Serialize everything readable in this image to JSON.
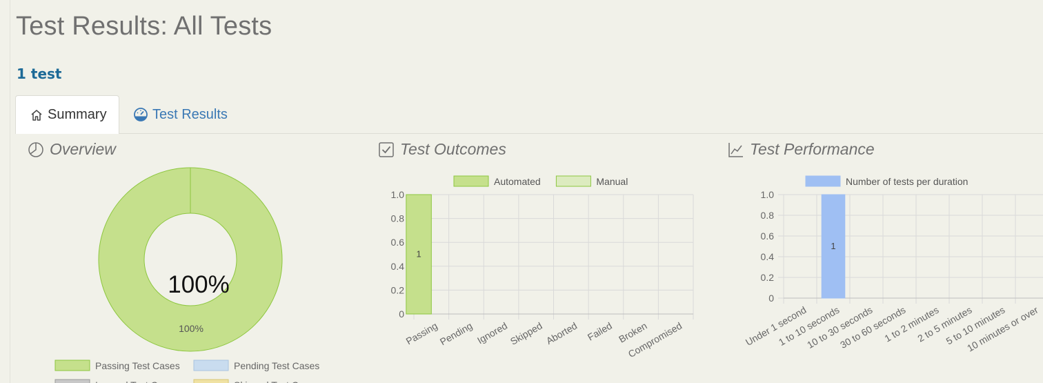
{
  "page": {
    "title": "Test Results: All Tests",
    "test_count": "1 test"
  },
  "tabs": [
    {
      "label": "Summary",
      "icon": "home-icon",
      "active": true
    },
    {
      "label": "Test Results",
      "icon": "speedometer-icon",
      "active": false
    }
  ],
  "sections": {
    "overview": {
      "title": "Overview",
      "icon": "pie-chart-icon"
    },
    "outcomes": {
      "title": "Test Outcomes",
      "icon": "checkbox-icon"
    },
    "performance": {
      "title": "Test Performance",
      "icon": "line-chart-icon"
    }
  },
  "colors": {
    "passing": "#c5e08c",
    "passing_border": "#8dc63f",
    "manual": "#dcebbf",
    "pending": "#c9dcef",
    "ignored": "#c8c8c8",
    "skipped": "#f0e2a3",
    "performance_bar": "#9fbff3"
  },
  "chart_data": [
    {
      "type": "pie",
      "title": "Overview",
      "center_label": "100%",
      "slice_label": "100%",
      "slices": [
        {
          "name": "Passing Test Cases",
          "value": 100
        }
      ],
      "legend": [
        "Passing Test Cases",
        "Pending Test Cases",
        "Ignored Test Cases",
        "Skipped Test Cases"
      ]
    },
    {
      "type": "bar",
      "title": "Test Outcomes",
      "categories": [
        "Passing",
        "Pending",
        "Ignored",
        "Skipped",
        "Aborted",
        "Failed",
        "Broken",
        "Compromised"
      ],
      "series": [
        {
          "name": "Automated",
          "values": [
            1,
            0,
            0,
            0,
            0,
            0,
            0,
            0
          ]
        },
        {
          "name": "Manual",
          "values": [
            0,
            0,
            0,
            0,
            0,
            0,
            0,
            0
          ]
        }
      ],
      "yticks": [
        "0",
        "0.2",
        "0.4",
        "0.6",
        "0.8",
        "1.0"
      ],
      "ylim": [
        0,
        1
      ],
      "data_labels": [
        "1"
      ]
    },
    {
      "type": "bar",
      "title": "Test Performance",
      "categories": [
        "Under 1 second",
        "1 to 10 seconds",
        "10 to 30 seconds",
        "30 to 60 seconds",
        "1 to 2 minutes",
        "2 to 5 minutes",
        "5 to 10 minutes",
        "10 minutes or over"
      ],
      "series": [
        {
          "name": "Number of tests per duration",
          "values": [
            0,
            1,
            0,
            0,
            0,
            0,
            0,
            0
          ]
        }
      ],
      "yticks": [
        "0",
        "0.2",
        "0.4",
        "0.6",
        "0.8",
        "1.0"
      ],
      "ylim": [
        0,
        1
      ],
      "data_labels": [
        "1"
      ]
    }
  ]
}
